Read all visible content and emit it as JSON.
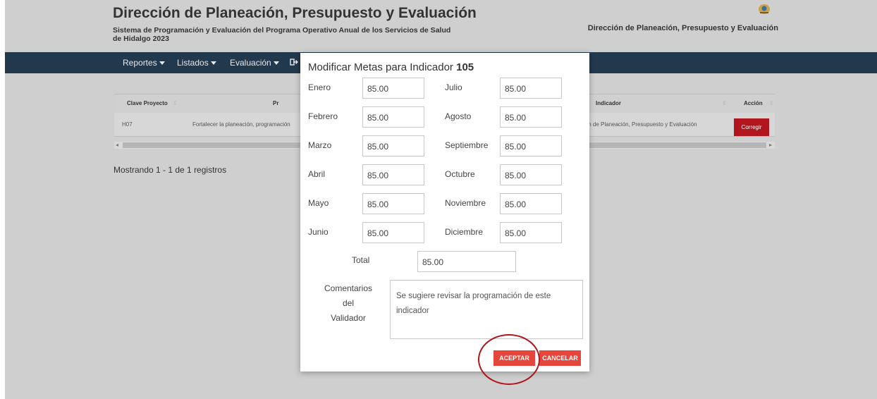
{
  "header": {
    "title": "Dirección de Planeación, Presupuesto y Evaluación",
    "subtitle": "Sistema de Programación y Evaluación del Programa Operativo Anual de los Servicios de Salud de Hidalgo 2023",
    "right_title": "Dirección de Planeación, Presupuesto y Evaluación"
  },
  "nav": {
    "items": [
      "Reportes",
      "Listados",
      "Evaluación"
    ]
  },
  "table": {
    "headers": [
      "Clave Proyecto",
      "Pr",
      "Indicador",
      "Acción"
    ],
    "row": {
      "clave": "H07",
      "proyecto": "Fortalecer la planeación, programación",
      "indicador": "ción de Planeación, Presupuesto y Evaluación",
      "action_label": "Corregir"
    }
  },
  "footer_text": "Mostrando 1 - 1 de 1 registros",
  "modal": {
    "title": "Modificar Metas para Indicador",
    "indicator_number": "105",
    "months": [
      {
        "label": "Enero",
        "value": "85.00"
      },
      {
        "label": "Febrero",
        "value": "85.00"
      },
      {
        "label": "Marzo",
        "value": "85.00"
      },
      {
        "label": "Abril",
        "value": "85.00"
      },
      {
        "label": "Mayo",
        "value": "85.00"
      },
      {
        "label": "Junio",
        "value": "85.00"
      },
      {
        "label": "Julio",
        "value": "85.00"
      },
      {
        "label": "Agosto",
        "value": "85.00"
      },
      {
        "label": "Septiembre",
        "value": "85.00"
      },
      {
        "label": "Octubre",
        "value": "85.00"
      },
      {
        "label": "Noviembre",
        "value": "85.00"
      },
      {
        "label": "Diciembre",
        "value": "85.00"
      }
    ],
    "total_label": "Total",
    "total_value": "85.00",
    "comments_label_1": "Comentarios",
    "comments_label_2": "del",
    "comments_label_3": "Validador",
    "comments_text": "Se sugiere revisar la programación de este indicador",
    "accept_label": "ACEPTAR",
    "cancel_label": "CANCELAR"
  },
  "colors": {
    "navbar": "#22384d",
    "action_red": "#b1151e",
    "modal_button": "#e5453a",
    "highlight_circle": "#b0151c"
  }
}
